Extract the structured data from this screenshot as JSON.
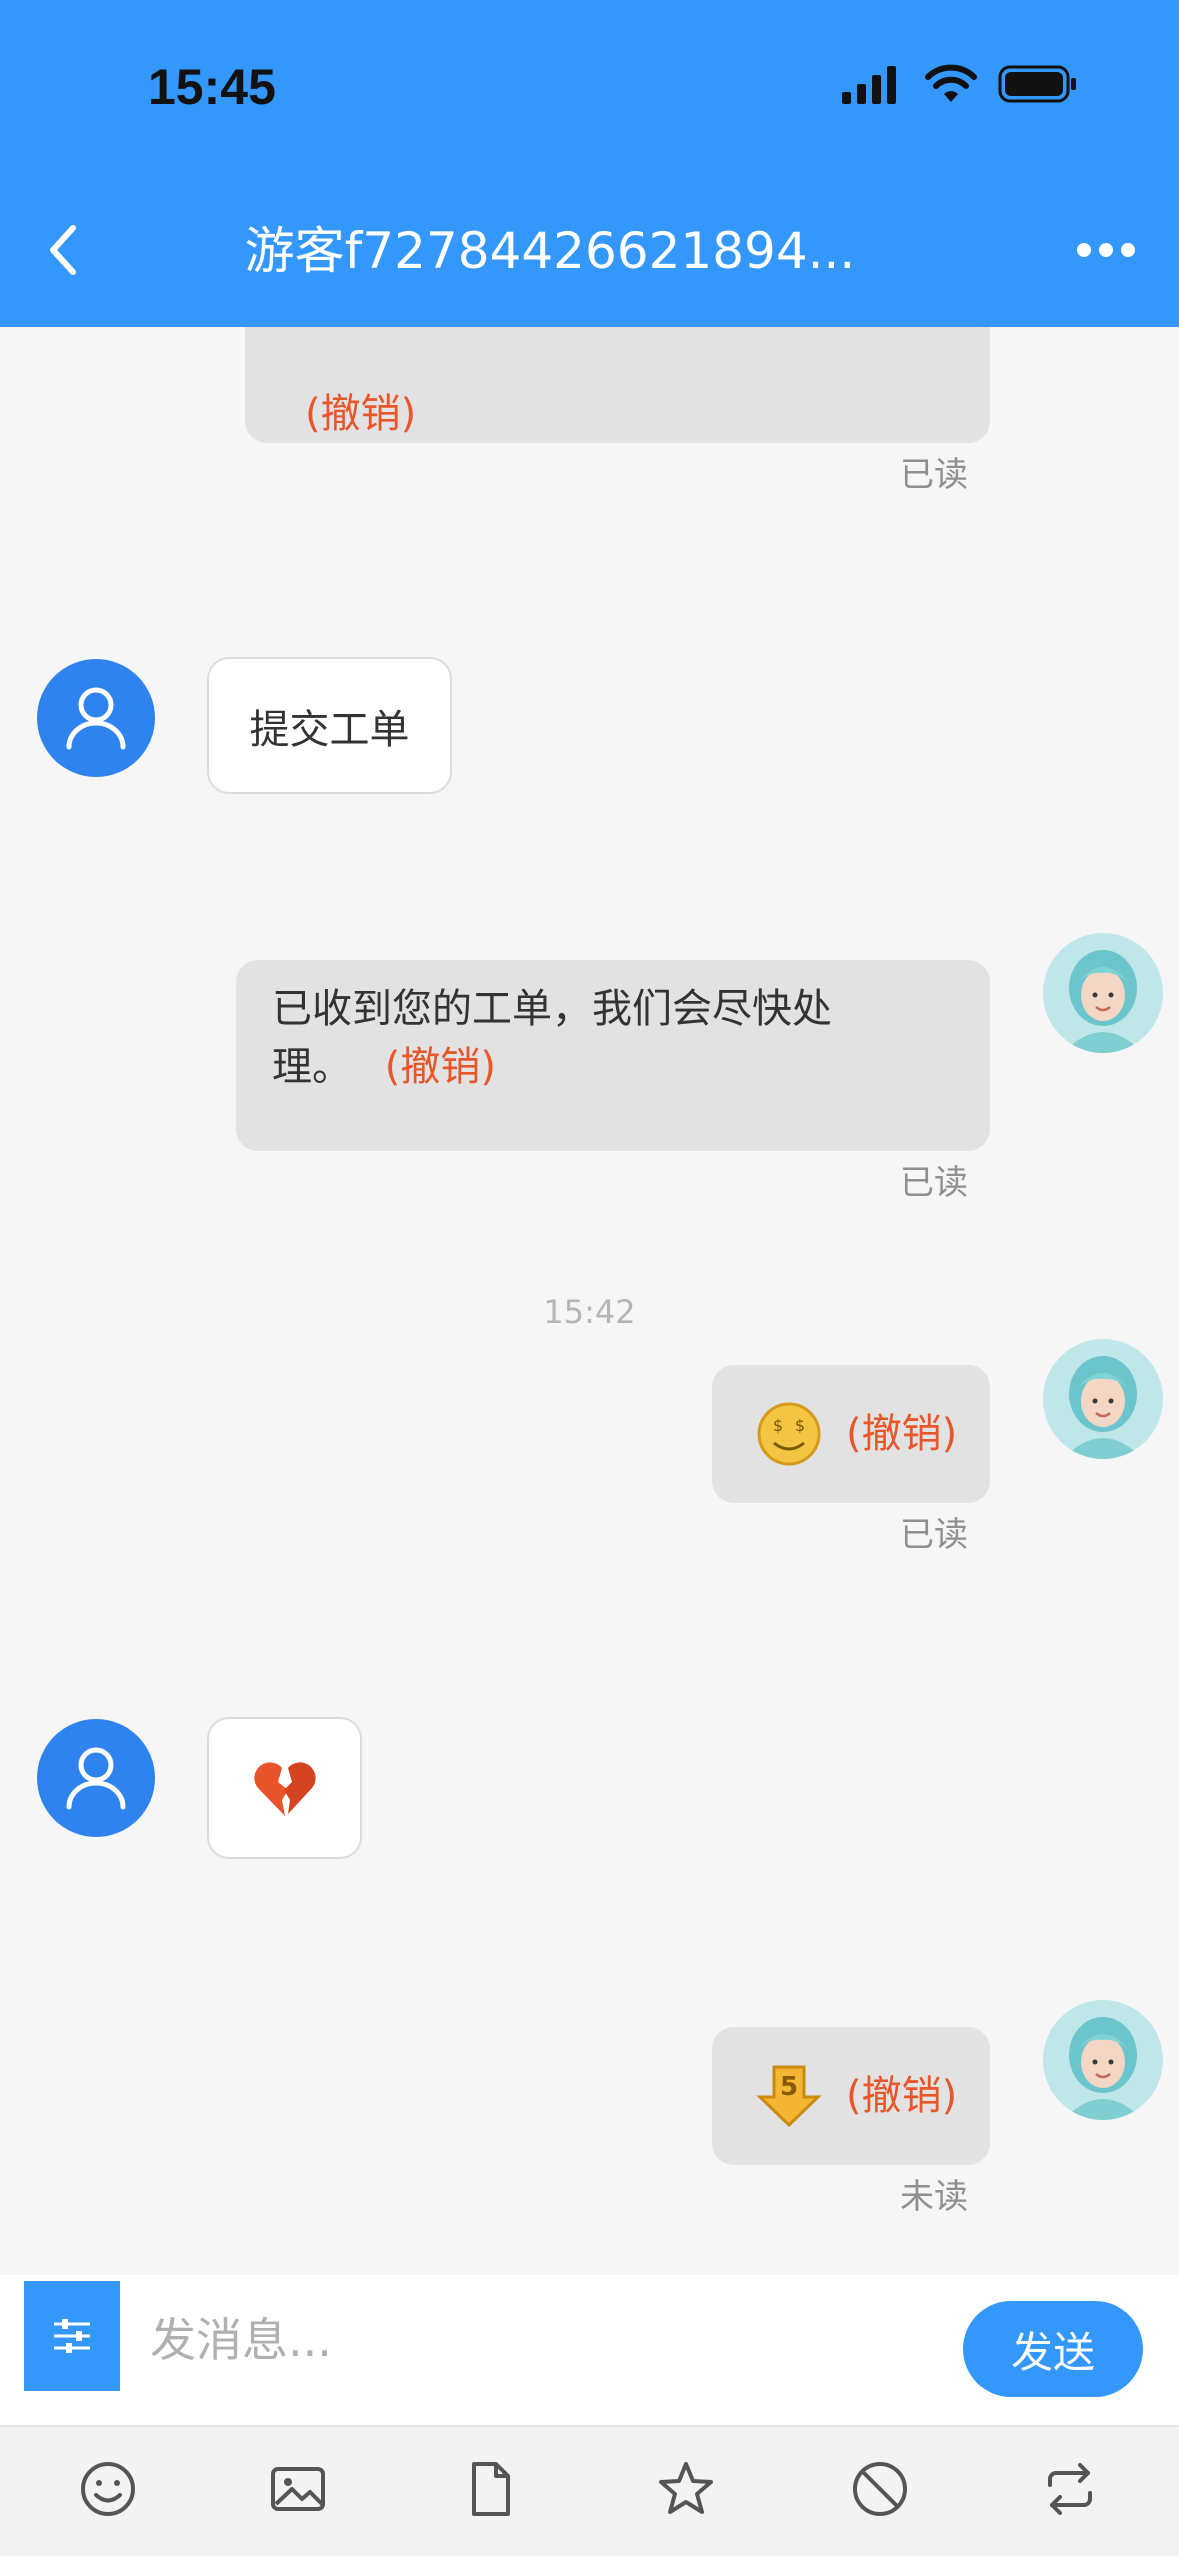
{
  "status_bar": {
    "time": "15:45"
  },
  "header": {
    "title": "游客f72784426621894..."
  },
  "messages": {
    "m1": {
      "recall": "(撤销)",
      "status": "已读"
    },
    "m2": {
      "text": "提交工单"
    },
    "m3": {
      "line1": "已收到您的工单，我们会尽快处",
      "line2": "理。",
      "recall": "(撤销)",
      "status": "已读"
    },
    "time_divider": "15:42",
    "m4": {
      "emoji": "money-face",
      "recall": "(撤销)",
      "status": "已读"
    },
    "m5": {
      "emoji": "broken-heart"
    },
    "m6": {
      "emoji": "download-5",
      "recall": "(撤销)",
      "status": "未读"
    }
  },
  "input": {
    "placeholder": "发消息...",
    "send_label": "发送"
  },
  "toolbar": {
    "icons": [
      "smile-icon",
      "image-icon",
      "file-icon",
      "star-icon",
      "block-icon",
      "transfer-icon"
    ]
  },
  "colors": {
    "brand": "#3397fb",
    "recall": "#e8562a",
    "user_avatar": "#2f83ef"
  }
}
